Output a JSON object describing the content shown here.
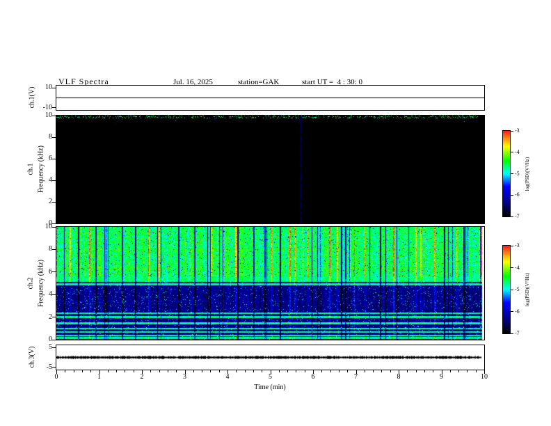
{
  "header": {
    "title": "VLF Spectra",
    "date": "Jul. 16, 2025",
    "station": "station=GAK",
    "start_ut": "start UT =  4 : 30: 0"
  },
  "time_axis": {
    "label": "Time (min)",
    "range": [
      0,
      10
    ],
    "ticks": [
      0,
      1,
      2,
      3,
      4,
      5,
      6,
      7,
      8,
      9,
      10
    ],
    "data_end_min": 9.85
  },
  "colormap": {
    "label": "log(PSD)(V²/Hz)",
    "range": [
      -7,
      -3
    ],
    "ticks": [
      -3,
      -4,
      -5,
      -6,
      -7
    ],
    "stops": [
      {
        "t": 0.0,
        "color": "#000000"
      },
      {
        "t": 0.15,
        "color": "#000080"
      },
      {
        "t": 0.35,
        "color": "#0000ff"
      },
      {
        "t": 0.5,
        "color": "#00ffff"
      },
      {
        "t": 0.65,
        "color": "#00ff00"
      },
      {
        "t": 0.82,
        "color": "#ffff00"
      },
      {
        "t": 1.0,
        "color": "#ff2020"
      }
    ]
  },
  "chart_data": [
    {
      "id": "ch1_waveform",
      "type": "line",
      "ylabel": "ch.1(V)",
      "ylim": [
        -10,
        10
      ],
      "yticks": [
        10,
        -10
      ],
      "xlim": [
        0,
        10
      ],
      "series": [
        {
          "name": "ch.1 voltage",
          "description": "flat trace at approximately 0 V across 0-10 min",
          "mean_V": 0,
          "amplitude_V": 0.1
        }
      ]
    },
    {
      "id": "ch1_spectrogram",
      "type": "heatmap",
      "channel": "ch.1",
      "ylabel": "Frequency (kHz)",
      "ylim": [
        0,
        10
      ],
      "yticks": [
        10,
        8,
        6,
        4,
        2,
        0
      ],
      "zlim": [
        -7,
        -3
      ],
      "background_psd": -7,
      "description": "Channel 1 power near noise floor (black, about -7) over 0-10 kHz; sparse impulsive specks confined to 9.7-10 kHz band; faint vertical broadband event near 5.7 min",
      "top_band_kHz": [
        9.7,
        10
      ],
      "speck_psd_range": [
        -5.2,
        -4.0
      ],
      "event_times_min": [
        5.7
      ],
      "seed": 11
    },
    {
      "id": "ch2_spectrogram",
      "type": "heatmap",
      "channel": "ch.2",
      "ylabel": "Frequency (kHz)",
      "ylim": [
        0,
        10
      ],
      "yticks": [
        10,
        8,
        6,
        4,
        2,
        0
      ],
      "zlim": [
        -7,
        -3
      ],
      "description": "Channel 2 broadband noise about -4.5 (green with yellow sferic streaks and dark dropouts) above 5.5 kHz; darker about -6.3 (dark blue with cyan speckle and vertical sferics) below 5 kHz; narrowband green emission lines",
      "band_split_kHz": 5.55,
      "upper_band_psd": -4.6,
      "lower_band_psd": -6.4,
      "line_freqs_kHz": [
        4.9,
        2.35,
        2.0,
        1.45,
        1.0,
        0.7,
        0.35,
        0.15
      ],
      "line_psd": -4.7,
      "seed": 7
    },
    {
      "id": "ch3_waveform",
      "type": "line",
      "ylabel": "ch.3(V)",
      "ylim": [
        -5,
        5
      ],
      "yticks": [
        5,
        -5
      ],
      "xlim": [
        0,
        10
      ],
      "series": [
        {
          "name": "ch.3 voltage",
          "description": "dense noisy trace centered at 0 V, about +/-0.5 V, 0-9.85 min",
          "mean_V": 0,
          "amplitude_V": 0.5
        }
      ]
    }
  ]
}
